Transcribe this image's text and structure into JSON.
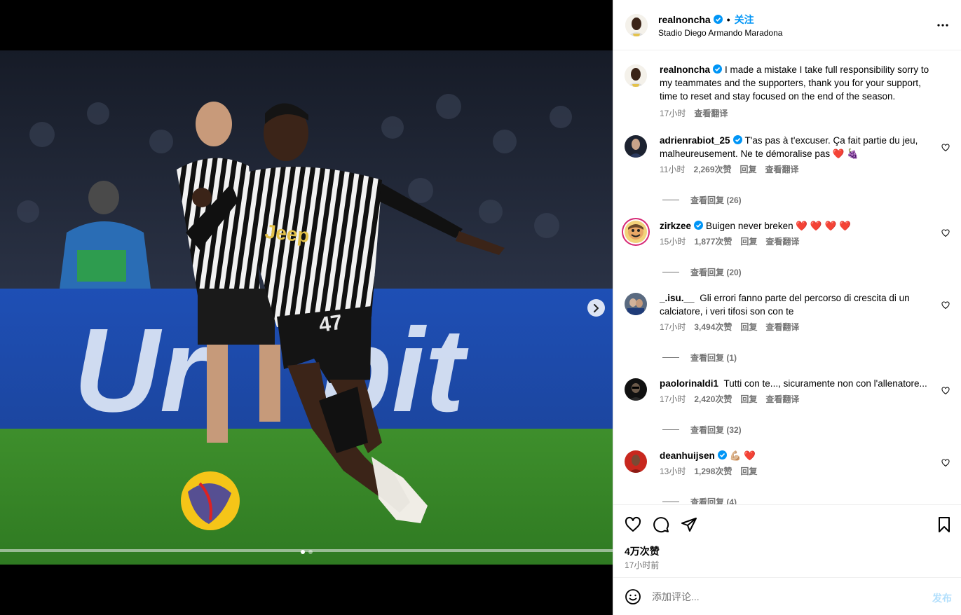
{
  "header": {
    "username": "realnoncha",
    "follow_label": "关注",
    "separator": "•",
    "location": "Stadio Diego Armando Maradona"
  },
  "caption": {
    "username": "realnoncha",
    "text": "I made a mistake I take full responsibility sorry to my teammates and the supporters, thank you for your support, time to reset and stay focused on the end of the season.",
    "time": "17小时",
    "translate": "查看翻译"
  },
  "comments": [
    {
      "username": "adrienrabiot_25",
      "verified": true,
      "text": "T'as pas à t'excuser. Ça fait partie du jeu, malheureusement. Ne te démoralise pas ❤️ 🍇",
      "time": "11小时",
      "likes": "2,269次赞",
      "reply": "回复",
      "translate": "查看翻译",
      "view_replies": "查看回复 (26)"
    },
    {
      "username": "zirkzee",
      "verified": true,
      "text": "Buigen never breken ❤️ ❤️ ❤️ ❤️",
      "time": "15小时",
      "likes": "1,877次赞",
      "reply": "回复",
      "translate": "查看翻译",
      "view_replies": "查看回复 (20)"
    },
    {
      "username": "_.isu.__",
      "verified": false,
      "text": "Gli errori fanno parte del percorso di crescita di un calciatore, i veri tifosi son con te",
      "time": "17小时",
      "likes": "3,494次赞",
      "reply": "回复",
      "translate": "查看翻译",
      "view_replies": "查看回复 (1)"
    },
    {
      "username": "paolorinaldi1",
      "verified": false,
      "text": "Tutti con te..., sicuramente non con l'allenatore...",
      "time": "17小时",
      "likes": "2,420次赞",
      "reply": "回复",
      "translate": "查看翻译",
      "view_replies": "查看回复 (32)"
    },
    {
      "username": "deanhuijsen",
      "verified": true,
      "text": "💪🏼 ❤️",
      "time": "13小时",
      "likes": "1,298次赞",
      "reply": "回复",
      "translate": "",
      "view_replies": "查看回复 (4)"
    }
  ],
  "footer": {
    "likes": "4万次赞",
    "time": "17小时前",
    "comment_placeholder": "添加评论...",
    "post_label": "发布"
  },
  "media": {
    "jersey_number": "47",
    "ad_text": "UniCredit",
    "carousel_count": 2,
    "carousel_active": 1
  },
  "colors": {
    "accent": "#0095f6",
    "verified": "#0095f6",
    "muted": "#737373"
  }
}
